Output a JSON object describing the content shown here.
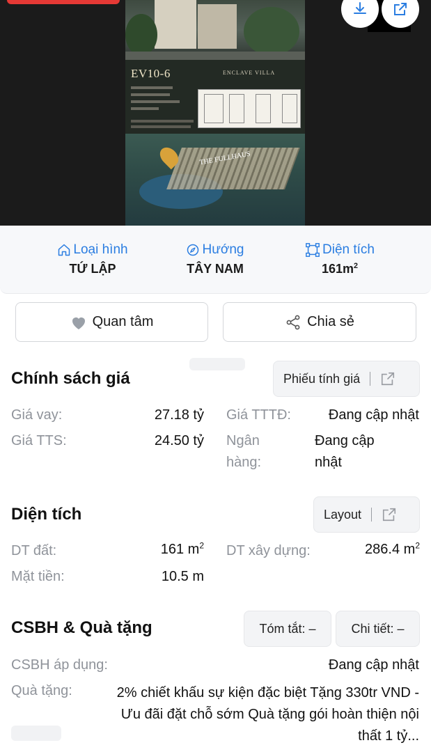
{
  "poster": {
    "code": "EV10-6",
    "villa_name": "ENCLAVE VILLA",
    "brand": "THE FULLHAUS"
  },
  "info": {
    "type_label": "Loại hình",
    "type_value": "TỨ LẬP",
    "direction_label": "Hướng",
    "direction_value": "TÂY NAM",
    "area_label": "Diện tích",
    "area_value": "161m",
    "area_unit_sup": "2"
  },
  "actions": {
    "favorite_label": "Quan tâm",
    "share_label": "Chia sẻ"
  },
  "pricing": {
    "title": "Chính sách giá",
    "button_label": "Phiếu tính giá",
    "loan_price_label": "Giá vay:",
    "loan_price_value": "27.18 tỷ",
    "tttd_label": "Giá TTTĐ:",
    "tttd_value": "Đang cập nhật",
    "tts_label": "Giá TTS:",
    "tts_value": "24.50 tỷ",
    "bank_label_1": "Ngân",
    "bank_label_2": "hàng:",
    "bank_value_1": "Đang cập",
    "bank_value_2": "nhật"
  },
  "area": {
    "title": "Diện tích",
    "button_label": "Layout",
    "land_label": "DT đất:",
    "land_value": "161 m",
    "land_sup": "2",
    "build_label": "DT xây dựng:",
    "build_value": "286.4 m",
    "build_sup": "2",
    "frontage_label": "Mặt tiền:",
    "frontage_value": "10.5 m"
  },
  "policy": {
    "title": "CSBH & Quà tặng",
    "summary_label": "Tóm tắt: –",
    "detail_label": "Chi tiết: –",
    "applied_label": "CSBH áp dụng:",
    "applied_value": "Đang cập nhật",
    "gift_label": "Quà tặng:",
    "gift_value": "2% chiết khấu sự kiện đặc biệt Tặng 330tr VND - Ưu đãi đặt chỗ sớm Quà tặng gói hoàn thiện nội thất 1 tỷ..."
  },
  "colors": {
    "accent": "#2a7de1",
    "muted": "#8f939a",
    "heart": "#9aa0a8"
  }
}
